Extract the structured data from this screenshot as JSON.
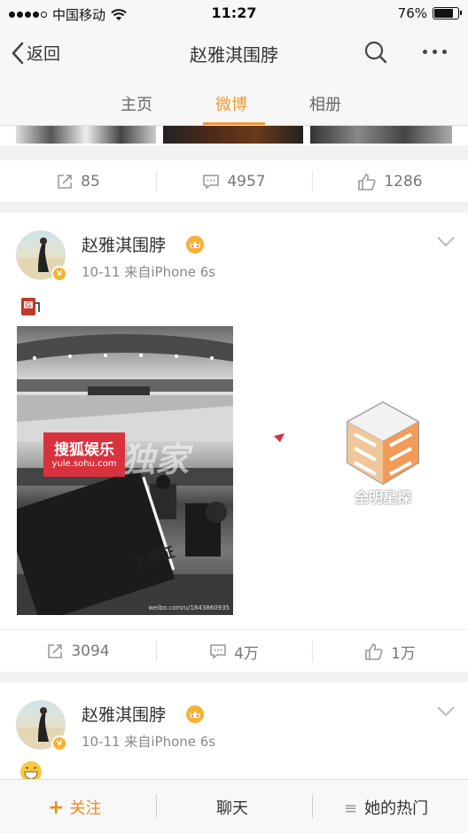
{
  "status_bar": {
    "carrier": "中国移动",
    "time": "11:27",
    "battery": "76%"
  },
  "nav": {
    "back_label": "返回",
    "title": "赵雅淇围脖"
  },
  "tabs": [
    {
      "label": "主页"
    },
    {
      "label": "微博"
    },
    {
      "label": "相册"
    }
  ],
  "active_tab": "微博",
  "post1_actions": {
    "repost": "85",
    "comment": "4957",
    "like": "1286"
  },
  "post2": {
    "username": "赵雅淇围脖",
    "meta": "10-11  来自iPhone 6s",
    "image_watermark": "搜狐娱乐",
    "image_watermark_url": "yule.sohu.com",
    "image_overlay_text": "独家",
    "badge_text": "工作证",
    "weibo_credit": "weibo.com/u/1843860935",
    "logo_text": "全明星探",
    "actions": {
      "repost": "3094",
      "comment": "4万",
      "like": "1万"
    }
  },
  "post3": {
    "username": "赵雅淇围脖",
    "meta": "10-11  来自iPhone 6s"
  },
  "bottom_bar": {
    "follow": "关注",
    "chat": "聊天",
    "hot": "她的热门"
  },
  "colors": {
    "accent": "#f09a37",
    "follow": "#f08a1c",
    "vip_badge": "#f6b233"
  }
}
